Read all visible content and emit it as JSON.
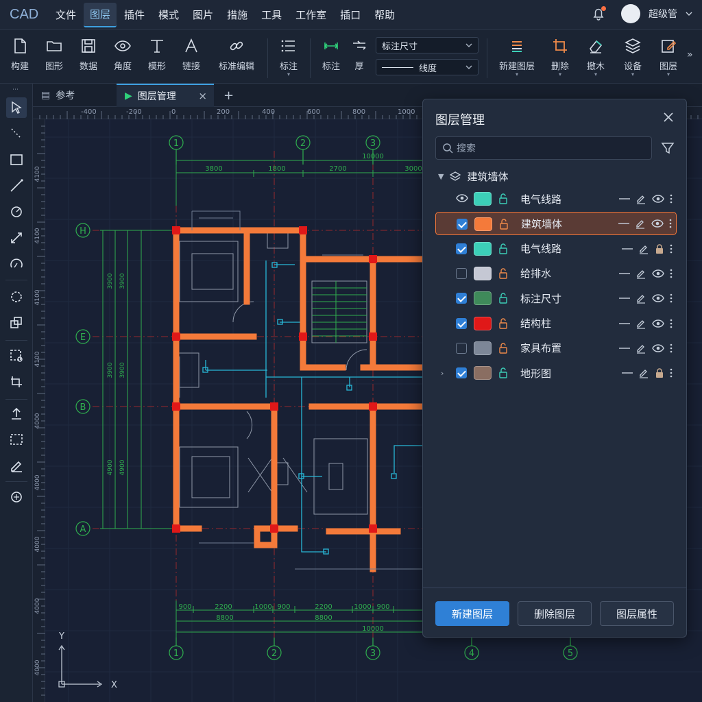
{
  "app": {
    "logo": "CAD",
    "user": "超级管"
  },
  "menu": [
    "文件",
    "图层",
    "插件",
    "模式",
    "图片",
    "措施",
    "工具",
    "工作室",
    "插口",
    "帮助"
  ],
  "menu_active_index": 1,
  "ribbon": {
    "buttons_left": [
      "构建",
      "图形",
      "数据",
      "角度",
      "模形",
      "链接",
      "标准编辑"
    ],
    "buttons_mid": [
      "标注",
      "标注",
      "厚"
    ],
    "dim_style_value": "标注尺寸",
    "linetype_value": "线度",
    "buttons_right": [
      "新建图层",
      "删除",
      "撤木",
      "设备",
      "图层"
    ]
  },
  "tabs": [
    {
      "label": "参考"
    },
    {
      "label": "图层管理",
      "close": "×"
    },
    {
      "label": "+"
    }
  ],
  "ruler_h": [
    "-400",
    "-200",
    "0",
    "200",
    "400",
    "600",
    "800",
    "1000"
  ],
  "ruler_v": [
    "4100",
    "4100",
    "4100",
    "4100",
    "4000",
    "4000",
    "4000",
    "4000",
    "4000"
  ],
  "drawing": {
    "top_axes": [
      "1",
      "2",
      "3"
    ],
    "bottom_axes": [
      "1",
      "2",
      "3",
      "4",
      "5"
    ],
    "side_axes": [
      "H",
      "E",
      "B",
      "A"
    ],
    "top_dims": [
      "3800",
      "1800",
      "2700",
      "3000"
    ],
    "top_total": "10000",
    "bottom_dims": [
      "900",
      "2200",
      "1000",
      "900",
      "2200",
      "1000",
      "900"
    ],
    "bottom_sub": [
      "8800",
      "8800"
    ],
    "bottom_total": "10000",
    "left_dims": [
      "3900",
      "3900",
      "3900",
      "3900",
      "4900",
      "4900"
    ],
    "ucs_y": "Y",
    "ucs_x": "X"
  },
  "layer_panel": {
    "title": "图层管理",
    "search_placeholder": "搜索",
    "group_name": "建筑墙体",
    "layers": [
      {
        "name": "电气线路",
        "color": "#3ccfb8",
        "visible_toggle": "eye",
        "checked": null,
        "lock": "unlocked",
        "lock_color": "#3ccfb8"
      },
      {
        "name": "建筑墙体",
        "color": "#f47a3a",
        "checked": true,
        "lock": "unlocked",
        "lock_color": "#f08a4a",
        "selected": true
      },
      {
        "name": "电气线路",
        "color": "#3ccfb8",
        "checked": true,
        "lock": "unlocked",
        "lock_color": "#3ccfb8"
      },
      {
        "name": "给排水",
        "color": "#c5c8d4",
        "checked": false,
        "lock": "unlocked",
        "lock_color": "#f08a4a"
      },
      {
        "name": "标注尺寸",
        "color": "#3f8a5a",
        "checked": true,
        "lock": "unlocked",
        "lock_color": "#3ccfb8"
      },
      {
        "name": "结构柱",
        "color": "#e01818",
        "checked": true,
        "lock": "unlocked",
        "lock_color": "#f08a4a"
      },
      {
        "name": "家具布置",
        "color": "#7d8798",
        "checked": false,
        "lock": "unlocked",
        "lock_color": "#f08a4a"
      },
      {
        "name": "地形图",
        "color": "#8a6e62",
        "checked": true,
        "lock": "unlocked",
        "lock_color": "#3ccfb8"
      }
    ],
    "buttons": {
      "new": "新建图层",
      "delete": "删除图层",
      "props": "图层属性"
    }
  },
  "colors": {
    "accent": "#2f80d6",
    "wall": "#f47a3a",
    "column": "#e01818",
    "dim": "#2fae4e",
    "pipe": "#28b8d8"
  }
}
